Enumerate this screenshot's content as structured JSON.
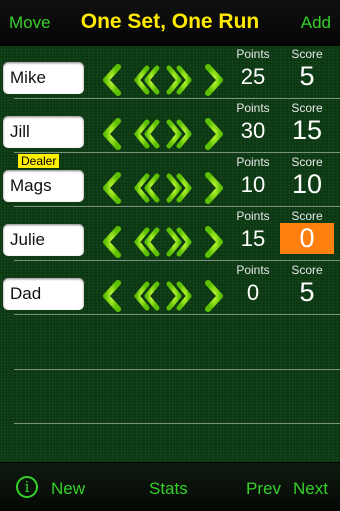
{
  "topbar": {
    "left": "Move",
    "title": "One Set, One Run",
    "right": "Add"
  },
  "labels": {
    "points": "Points",
    "score": "Score"
  },
  "players": [
    {
      "name": "Mike",
      "points": "25",
      "score": "5",
      "dealer": ""
    },
    {
      "name": "Jill",
      "points": "30",
      "score": "15",
      "dealer": ""
    },
    {
      "name": "Mags",
      "points": "10",
      "score": "10",
      "dealer": "Dealer"
    },
    {
      "name": "Julie",
      "points": "15",
      "score": "0",
      "dealer": ""
    },
    {
      "name": "Dad",
      "points": "0",
      "score": "5",
      "dealer": ""
    }
  ],
  "bottombar": {
    "info": "i",
    "new": "New",
    "stats": "Stats",
    "prev": "Prev",
    "next": "Next"
  },
  "colors": {
    "accent": "#35d02a",
    "title": "#ffea00",
    "highlight": "#ff7f0f",
    "dealer": "#ffef00",
    "arrow": "#8fe000"
  },
  "icons": [
    "left-arrow-icon",
    "double-left-arrow-icon",
    "double-right-arrow-icon",
    "right-arrow-icon",
    "info-icon"
  ]
}
